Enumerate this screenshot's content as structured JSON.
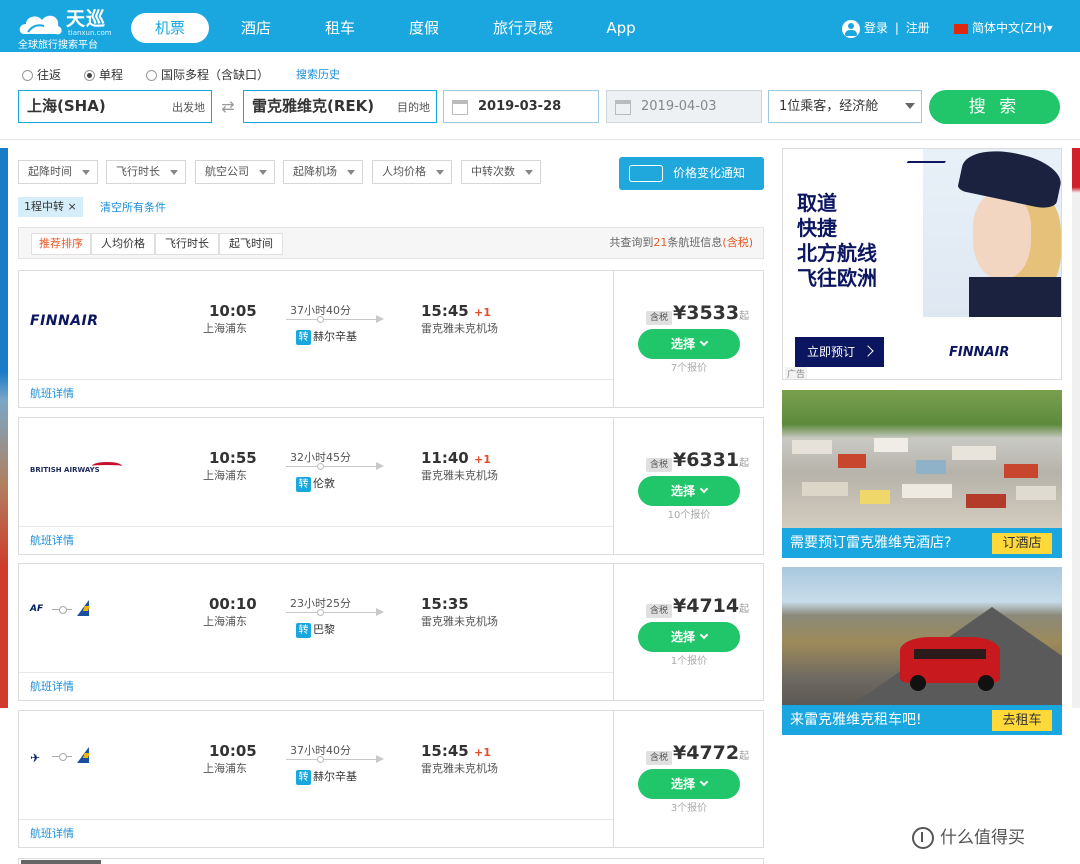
{
  "header": {
    "brand": "天巡",
    "domain": "tianxun.com",
    "slogan": "全球旅行搜索平台",
    "nav": [
      "机票",
      "酒店",
      "租车",
      "度假",
      "旅行灵感",
      "App"
    ],
    "active_nav": "机票",
    "login": "登录",
    "separator": "|",
    "register": "注册",
    "language": "简体中文(ZH)▾",
    "accent_color": "#1aa7e0"
  },
  "search": {
    "trip_types": [
      "往返",
      "单程",
      "国际多程（含缺口）"
    ],
    "selected_trip_type": "单程",
    "history_link": "搜索历史",
    "origin": "上海(SHA)",
    "origin_tag": "出发地",
    "destination": "雷克雅维克(REK)",
    "destination_tag": "目的地",
    "depart_date": "2019-03-28",
    "return_date": "2019-04-03",
    "passengers": "1位乘客，经济舱",
    "search_button": "搜 索",
    "search_button_color": "#20c669"
  },
  "filters": {
    "dropdowns": [
      "起降时间",
      "飞行时长",
      "航空公司",
      "起降机场",
      "人均价格",
      "中转次数"
    ],
    "price_alert": "价格变化通知",
    "active_chip": "1程中转 ×",
    "clear_all": "清空所有条件"
  },
  "sort": {
    "tabs": [
      "推荐排序",
      "人均价格",
      "飞行时长",
      "起飞时间"
    ],
    "active_tab": "推荐排序",
    "result_prefix": "共查询到",
    "result_count": "21",
    "result_suffix": "条航班信息",
    "tax_note": "(含税)"
  },
  "flights": [
    {
      "airline": "FINNAIR",
      "logo_type": "finnair",
      "depart_time": "10:05",
      "depart_airport": "上海浦东",
      "duration": "37小时40分",
      "transit_label": "转",
      "transit_city": "赫尔辛基",
      "arrive_time": "15:45",
      "day_offset": "+1",
      "arrive_airport": "雷克雅未克机场",
      "tax_tag": "含税",
      "price": "¥3533",
      "price_suffix": "起",
      "select_label": "选择",
      "quotes": "7个报价",
      "detail_link": "航班详情"
    },
    {
      "airline": "BRITISH AIRWAYS",
      "logo_type": "ba",
      "depart_time": "10:55",
      "depart_airport": "上海浦东",
      "duration": "32小时45分",
      "transit_label": "转",
      "transit_city": "伦敦",
      "arrive_time": "11:40",
      "day_offset": "+1",
      "arrive_airport": "雷克雅未克机场",
      "tax_tag": "含税",
      "price": "¥6331",
      "price_suffix": "起",
      "select_label": "选择",
      "quotes": "10个报价",
      "detail_link": "航班详情"
    },
    {
      "airline": "AF",
      "logo_type": "multi-af",
      "depart_time": "00:10",
      "depart_airport": "上海浦东",
      "duration": "23小时25分",
      "transit_label": "转",
      "transit_city": "巴黎",
      "arrive_time": "15:35",
      "day_offset": "",
      "arrive_airport": "雷克雅未克机场",
      "tax_tag": "含税",
      "price": "¥4714",
      "price_suffix": "起",
      "select_label": "选择",
      "quotes": "1个报价",
      "detail_link": "航班详情"
    },
    {
      "airline": "",
      "logo_type": "multi",
      "depart_time": "10:05",
      "depart_airport": "上海浦东",
      "duration": "37小时40分",
      "transit_label": "转",
      "transit_city": "赫尔辛基",
      "arrive_time": "15:45",
      "day_offset": "+1",
      "arrive_airport": "雷克雅未克机场",
      "tax_tag": "含税",
      "price": "¥4772",
      "price_suffix": "起",
      "select_label": "选择",
      "quotes": "3个报价",
      "detail_link": "航班详情"
    }
  ],
  "ads": {
    "finnair": {
      "lines": [
        "取道",
        "快捷",
        "北方航线",
        "飞往欧洲"
      ],
      "button": "立即预订",
      "logo": "FINNAIR",
      "ad_mark": "广告"
    },
    "hotel": {
      "text": "需要预订雷克雅维克酒店?",
      "button": "订酒店"
    },
    "car": {
      "text": "来雷克雅维克租车吧!",
      "button": "去租车"
    }
  },
  "watermark": "什么值得买"
}
